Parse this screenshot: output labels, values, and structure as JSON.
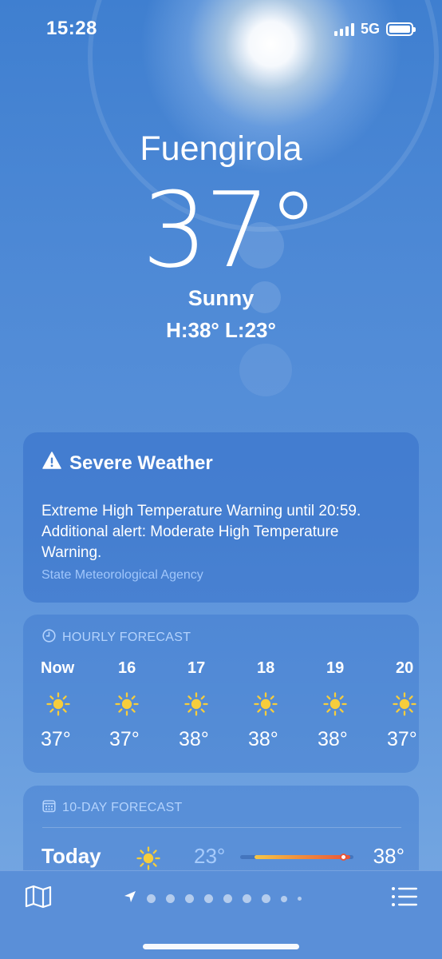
{
  "status_bar": {
    "time": "15:28",
    "network": "5G"
  },
  "location": {
    "city": "Fuengirola",
    "temperature": "37°",
    "condition": "Sunny",
    "high_low": "H:38°  L:23°"
  },
  "alert": {
    "title": "Severe Weather",
    "body": "Extreme High Temperature Warning until 20:59. Additional alert: Moderate High Temperature Warning.",
    "source": "State Meteorological Agency",
    "icon": "warning-triangle-icon"
  },
  "hourly": {
    "label": "HOURLY FORECAST",
    "icon": "clock-icon",
    "hours": [
      {
        "time": "Now",
        "icon": "sun-icon",
        "temp": "37°"
      },
      {
        "time": "16",
        "icon": "sun-icon",
        "temp": "37°"
      },
      {
        "time": "17",
        "icon": "sun-icon",
        "temp": "38°"
      },
      {
        "time": "18",
        "icon": "sun-icon",
        "temp": "38°"
      },
      {
        "time": "19",
        "icon": "sun-icon",
        "temp": "38°"
      },
      {
        "time": "20",
        "icon": "sun-icon",
        "temp": "37°"
      }
    ]
  },
  "ten_day": {
    "label": "10-DAY FORECAST",
    "icon": "calendar-icon",
    "today": {
      "day": "Today",
      "icon": "sun-icon",
      "low": "23°",
      "high": "38°"
    }
  },
  "bottom_bar": {
    "map_icon": "map-icon",
    "list_icon": "list-icon",
    "location_icon": "location-arrow-icon"
  },
  "colors": {
    "sun_yellow": "#f6cd3c",
    "range_start": "#f5c646",
    "range_end": "#e8553a"
  }
}
